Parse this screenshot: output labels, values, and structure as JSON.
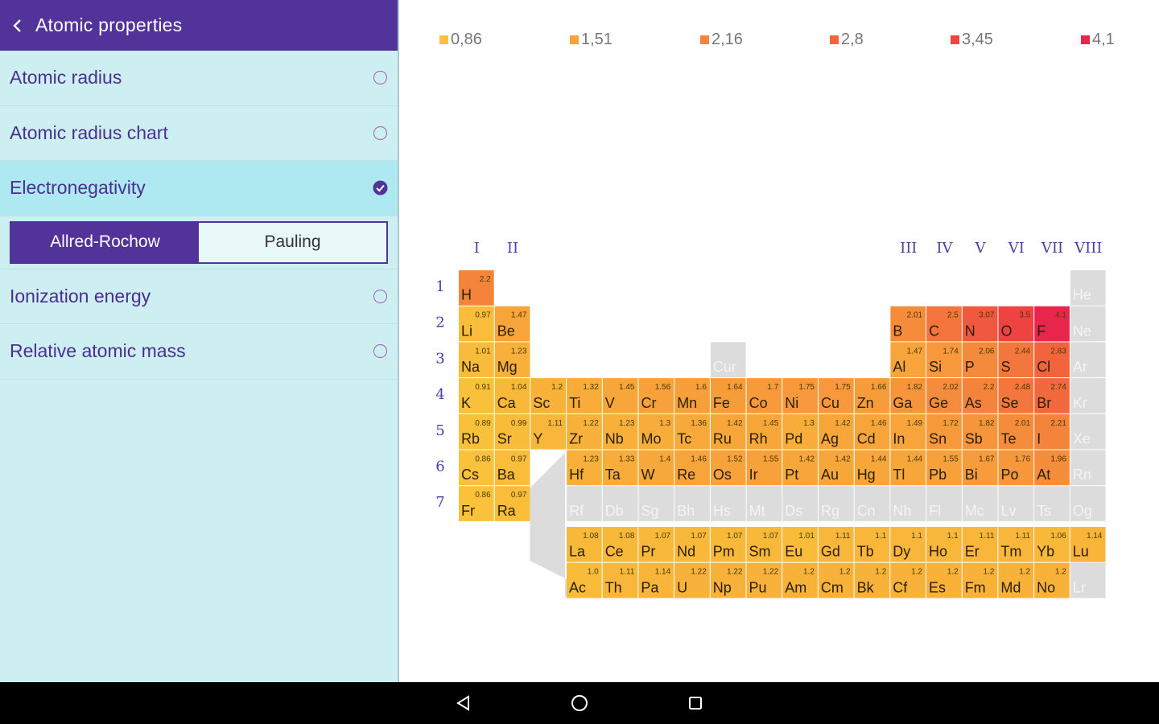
{
  "header": {
    "title": "Atomic properties"
  },
  "menu": {
    "items": [
      {
        "label": "Atomic radius",
        "selected": false
      },
      {
        "label": "Atomic radius chart",
        "selected": false
      },
      {
        "label": "Electronegativity",
        "selected": true
      }
    ],
    "segment": {
      "options": [
        "Allred-Rochow",
        "Pauling"
      ],
      "active": "Allred-Rochow"
    },
    "items_after": [
      {
        "label": "Ionization energy",
        "selected": false
      },
      {
        "label": "Relative atomic mass",
        "selected": false
      }
    ]
  },
  "colors": {
    "accent": "#52339a",
    "sidebar_bg": "#cdeff2",
    "selected_bg": "#aee9f1",
    "empty_cell": "#dcdcdc"
  },
  "legend": [
    {
      "label": "0,86",
      "color": "#f9c23a"
    },
    {
      "label": "1,51",
      "color": "#f7a33a"
    },
    {
      "label": "2,16",
      "color": "#f4853c"
    },
    {
      "label": "2,8",
      "color": "#f2663e"
    },
    {
      "label": "3,45",
      "color": "#ee4442"
    },
    {
      "label": "4,1",
      "color": "#e8254b"
    }
  ],
  "group_labels": [
    "I",
    "II",
    "III",
    "IV",
    "V",
    "VI",
    "VII",
    "VIII"
  ],
  "period_labels": [
    "1",
    "2",
    "3",
    "4",
    "5",
    "6",
    "7"
  ],
  "elements": [
    {
      "sym": "H",
      "val": "2.2",
      "period": 1,
      "group": 1
    },
    {
      "sym": "He",
      "val": null,
      "period": 1,
      "group": 18
    },
    {
      "sym": "Li",
      "val": "0.97",
      "period": 2,
      "group": 1
    },
    {
      "sym": "Be",
      "val": "1.47",
      "period": 2,
      "group": 2
    },
    {
      "sym": "B",
      "val": "2.01",
      "period": 2,
      "group": 13
    },
    {
      "sym": "C",
      "val": "2.5",
      "period": 2,
      "group": 14
    },
    {
      "sym": "N",
      "val": "3.07",
      "period": 2,
      "group": 15
    },
    {
      "sym": "O",
      "val": "3.5",
      "period": 2,
      "group": 16
    },
    {
      "sym": "F",
      "val": "4.1",
      "period": 2,
      "group": 17
    },
    {
      "sym": "Ne",
      "val": null,
      "period": 2,
      "group": 18
    },
    {
      "sym": "Na",
      "val": "1.01",
      "period": 3,
      "group": 1
    },
    {
      "sym": "Mg",
      "val": "1.23",
      "period": 3,
      "group": 2
    },
    {
      "sym": "Cur",
      "val": null,
      "period": 3,
      "group": 8
    },
    {
      "sym": "Al",
      "val": "1.47",
      "period": 3,
      "group": 13
    },
    {
      "sym": "Si",
      "val": "1.74",
      "period": 3,
      "group": 14
    },
    {
      "sym": "P",
      "val": "2.06",
      "period": 3,
      "group": 15
    },
    {
      "sym": "S",
      "val": "2.44",
      "period": 3,
      "group": 16
    },
    {
      "sym": "Cl",
      "val": "2.83",
      "period": 3,
      "group": 17
    },
    {
      "sym": "Ar",
      "val": null,
      "period": 3,
      "group": 18
    },
    {
      "sym": "K",
      "val": "0.91",
      "period": 4,
      "group": 1
    },
    {
      "sym": "Ca",
      "val": "1.04",
      "period": 4,
      "group": 2
    },
    {
      "sym": "Sc",
      "val": "1.2",
      "period": 4,
      "group": 3
    },
    {
      "sym": "Ti",
      "val": "1.32",
      "period": 4,
      "group": 4
    },
    {
      "sym": "V",
      "val": "1.45",
      "period": 4,
      "group": 5
    },
    {
      "sym": "Cr",
      "val": "1.56",
      "period": 4,
      "group": 6
    },
    {
      "sym": "Mn",
      "val": "1.6",
      "period": 4,
      "group": 7
    },
    {
      "sym": "Fe",
      "val": "1.64",
      "period": 4,
      "group": 8
    },
    {
      "sym": "Co",
      "val": "1.7",
      "period": 4,
      "group": 9
    },
    {
      "sym": "Ni",
      "val": "1.75",
      "period": 4,
      "group": 10
    },
    {
      "sym": "Cu",
      "val": "1.75",
      "period": 4,
      "group": 11
    },
    {
      "sym": "Zn",
      "val": "1.66",
      "period": 4,
      "group": 12
    },
    {
      "sym": "Ga",
      "val": "1.82",
      "period": 4,
      "group": 13
    },
    {
      "sym": "Ge",
      "val": "2.02",
      "period": 4,
      "group": 14
    },
    {
      "sym": "As",
      "val": "2.2",
      "period": 4,
      "group": 15
    },
    {
      "sym": "Se",
      "val": "2.48",
      "period": 4,
      "group": 16
    },
    {
      "sym": "Br",
      "val": "2.74",
      "period": 4,
      "group": 17
    },
    {
      "sym": "Kr",
      "val": null,
      "period": 4,
      "group": 18
    },
    {
      "sym": "Rb",
      "val": "0.89",
      "period": 5,
      "group": 1
    },
    {
      "sym": "Sr",
      "val": "0.99",
      "period": 5,
      "group": 2
    },
    {
      "sym": "Y",
      "val": "1.11",
      "period": 5,
      "group": 3
    },
    {
      "sym": "Zr",
      "val": "1.22",
      "period": 5,
      "group": 4
    },
    {
      "sym": "Nb",
      "val": "1.23",
      "period": 5,
      "group": 5
    },
    {
      "sym": "Mo",
      "val": "1.3",
      "period": 5,
      "group": 6
    },
    {
      "sym": "Tc",
      "val": "1.36",
      "period": 5,
      "group": 7
    },
    {
      "sym": "Ru",
      "val": "1.42",
      "period": 5,
      "group": 8
    },
    {
      "sym": "Rh",
      "val": "1.45",
      "period": 5,
      "group": 9
    },
    {
      "sym": "Pd",
      "val": "1.3",
      "period": 5,
      "group": 10
    },
    {
      "sym": "Ag",
      "val": "1.42",
      "period": 5,
      "group": 11
    },
    {
      "sym": "Cd",
      "val": "1.46",
      "period": 5,
      "group": 12
    },
    {
      "sym": "In",
      "val": "1.49",
      "period": 5,
      "group": 13
    },
    {
      "sym": "Sn",
      "val": "1.72",
      "period": 5,
      "group": 14
    },
    {
      "sym": "Sb",
      "val": "1.82",
      "period": 5,
      "group": 15
    },
    {
      "sym": "Te",
      "val": "2.01",
      "period": 5,
      "group": 16
    },
    {
      "sym": "I",
      "val": "2.21",
      "period": 5,
      "group": 17
    },
    {
      "sym": "Xe",
      "val": null,
      "period": 5,
      "group": 18
    },
    {
      "sym": "Cs",
      "val": "0.86",
      "period": 6,
      "group": 1
    },
    {
      "sym": "Ba",
      "val": "0.97",
      "period": 6,
      "group": 2
    },
    {
      "sym": "Hf",
      "val": "1.23",
      "period": 6,
      "group": 4
    },
    {
      "sym": "Ta",
      "val": "1.33",
      "period": 6,
      "group": 5
    },
    {
      "sym": "W",
      "val": "1.4",
      "period": 6,
      "group": 6
    },
    {
      "sym": "Re",
      "val": "1.46",
      "period": 6,
      "group": 7
    },
    {
      "sym": "Os",
      "val": "1.52",
      "period": 6,
      "group": 8
    },
    {
      "sym": "Ir",
      "val": "1.55",
      "period": 6,
      "group": 9
    },
    {
      "sym": "Pt",
      "val": "1.42",
      "period": 6,
      "group": 10
    },
    {
      "sym": "Au",
      "val": "1.42",
      "period": 6,
      "group": 11
    },
    {
      "sym": "Hg",
      "val": "1.44",
      "period": 6,
      "group": 12
    },
    {
      "sym": "Tl",
      "val": "1.44",
      "period": 6,
      "group": 13
    },
    {
      "sym": "Pb",
      "val": "1.55",
      "period": 6,
      "group": 14
    },
    {
      "sym": "Bi",
      "val": "1.67",
      "period": 6,
      "group": 15
    },
    {
      "sym": "Po",
      "val": "1.76",
      "period": 6,
      "group": 16
    },
    {
      "sym": "At",
      "val": "1.96",
      "period": 6,
      "group": 17
    },
    {
      "sym": "Rn",
      "val": null,
      "period": 6,
      "group": 18
    },
    {
      "sym": "Fr",
      "val": "0.86",
      "period": 7,
      "group": 1
    },
    {
      "sym": "Ra",
      "val": "0.97",
      "period": 7,
      "group": 2
    },
    {
      "sym": "Rf",
      "val": null,
      "period": 7,
      "group": 4
    },
    {
      "sym": "Db",
      "val": null,
      "period": 7,
      "group": 5
    },
    {
      "sym": "Sg",
      "val": null,
      "period": 7,
      "group": 6
    },
    {
      "sym": "Bh",
      "val": null,
      "period": 7,
      "group": 7
    },
    {
      "sym": "Hs",
      "val": null,
      "period": 7,
      "group": 8
    },
    {
      "sym": "Mt",
      "val": null,
      "period": 7,
      "group": 9
    },
    {
      "sym": "Ds",
      "val": null,
      "period": 7,
      "group": 10
    },
    {
      "sym": "Rg",
      "val": null,
      "period": 7,
      "group": 11
    },
    {
      "sym": "Cn",
      "val": null,
      "period": 7,
      "group": 12
    },
    {
      "sym": "Nh",
      "val": null,
      "period": 7,
      "group": 13
    },
    {
      "sym": "Fl",
      "val": null,
      "period": 7,
      "group": 14
    },
    {
      "sym": "Mc",
      "val": null,
      "period": 7,
      "group": 15
    },
    {
      "sym": "Lv",
      "val": null,
      "period": 7,
      "group": 16
    },
    {
      "sym": "Ts",
      "val": null,
      "period": 7,
      "group": 17
    },
    {
      "sym": "Og",
      "val": null,
      "period": 7,
      "group": 18
    }
  ],
  "lanthanides": [
    {
      "sym": "La",
      "val": "1.08"
    },
    {
      "sym": "Ce",
      "val": "1.08"
    },
    {
      "sym": "Pr",
      "val": "1.07"
    },
    {
      "sym": "Nd",
      "val": "1.07"
    },
    {
      "sym": "Pm",
      "val": "1.07"
    },
    {
      "sym": "Sm",
      "val": "1.07"
    },
    {
      "sym": "Eu",
      "val": "1.01"
    },
    {
      "sym": "Gd",
      "val": "1.11"
    },
    {
      "sym": "Tb",
      "val": "1.1"
    },
    {
      "sym": "Dy",
      "val": "1.1"
    },
    {
      "sym": "Ho",
      "val": "1.1"
    },
    {
      "sym": "Er",
      "val": "1.11"
    },
    {
      "sym": "Tm",
      "val": "1.11"
    },
    {
      "sym": "Yb",
      "val": "1.06"
    },
    {
      "sym": "Lu",
      "val": "1.14"
    }
  ],
  "actinides": [
    {
      "sym": "Ac",
      "val": "1.0"
    },
    {
      "sym": "Th",
      "val": "1.11"
    },
    {
      "sym": "Pa",
      "val": "1.14"
    },
    {
      "sym": "U",
      "val": "1.22"
    },
    {
      "sym": "Np",
      "val": "1.22"
    },
    {
      "sym": "Pu",
      "val": "1.22"
    },
    {
      "sym": "Am",
      "val": "1.2"
    },
    {
      "sym": "Cm",
      "val": "1.2"
    },
    {
      "sym": "Bk",
      "val": "1.2"
    },
    {
      "sym": "Cf",
      "val": "1.2"
    },
    {
      "sym": "Es",
      "val": "1.2"
    },
    {
      "sym": "Fm",
      "val": "1.2"
    },
    {
      "sym": "Md",
      "val": "1.2"
    },
    {
      "sym": "No",
      "val": "1.2"
    },
    {
      "sym": "Lr",
      "val": null
    }
  ],
  "navbar": {
    "icons": [
      "back-icon",
      "home-icon",
      "recents-icon"
    ]
  }
}
